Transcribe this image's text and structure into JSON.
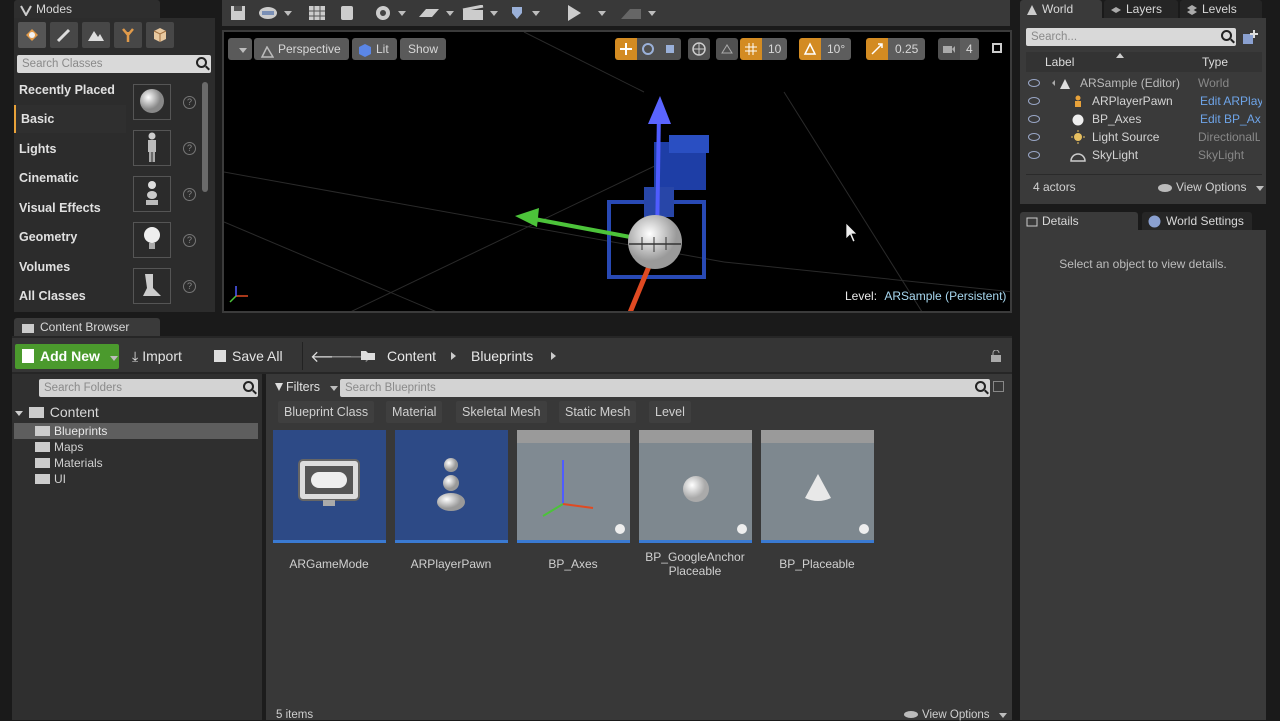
{
  "modes": {
    "tab_label": "Modes",
    "search_placeholder": "Search Classes",
    "categories": [
      "Recently Placed",
      "Basic",
      "Lights",
      "Cinematic",
      "Visual Effects",
      "Geometry",
      "Volumes",
      "All Classes"
    ],
    "selected_category": "Basic"
  },
  "viewport": {
    "perspective_label": "Perspective",
    "lit_label": "Lit",
    "show_label": "Show",
    "grid_snap": "10",
    "rotation_snap": "10°",
    "scale_snap": "0.25",
    "camera_speed": "4",
    "level_prefix": "Level:",
    "level_name": "ARSample (Persistent)"
  },
  "outliner": {
    "tabs": [
      "World",
      "Layers",
      "Levels"
    ],
    "search_placeholder": "Search...",
    "col_label": "Label",
    "col_type": "Type",
    "rows": [
      {
        "label": "ARSample (Editor)",
        "type": "World"
      },
      {
        "label": "ARPlayerPawn",
        "type": "Edit ARPlay"
      },
      {
        "label": "BP_Axes",
        "type": "Edit BP_Ax"
      },
      {
        "label": "Light Source",
        "type": "DirectionalL"
      },
      {
        "label": "SkyLight",
        "type": "SkyLight"
      }
    ],
    "actor_count": "4 actors",
    "view_options": "View Options"
  },
  "details": {
    "tabs": [
      "Details",
      "World Settings"
    ],
    "empty_message": "Select an object to view details."
  },
  "content_browser": {
    "tab_label": "Content Browser",
    "add_new": "Add New",
    "import": "Import",
    "save_all": "Save All",
    "path": [
      "Content",
      "Blueprints"
    ],
    "folder_search_placeholder": "Search Folders",
    "folders": {
      "root": "Content",
      "children": [
        "Blueprints",
        "Maps",
        "Materials",
        "UI"
      ]
    },
    "filters_label": "Filters",
    "asset_search_placeholder": "Search Blueprints",
    "filter_chips": [
      "Blueprint Class",
      "Material",
      "Skeletal Mesh",
      "Static Mesh",
      "Level"
    ],
    "assets": [
      "ARGameMode",
      "ARPlayerPawn",
      "BP_Axes",
      "BP_GoogleAnchor Placeable",
      "BP_Placeable"
    ],
    "item_count": "5 items",
    "view_options": "View Options"
  }
}
